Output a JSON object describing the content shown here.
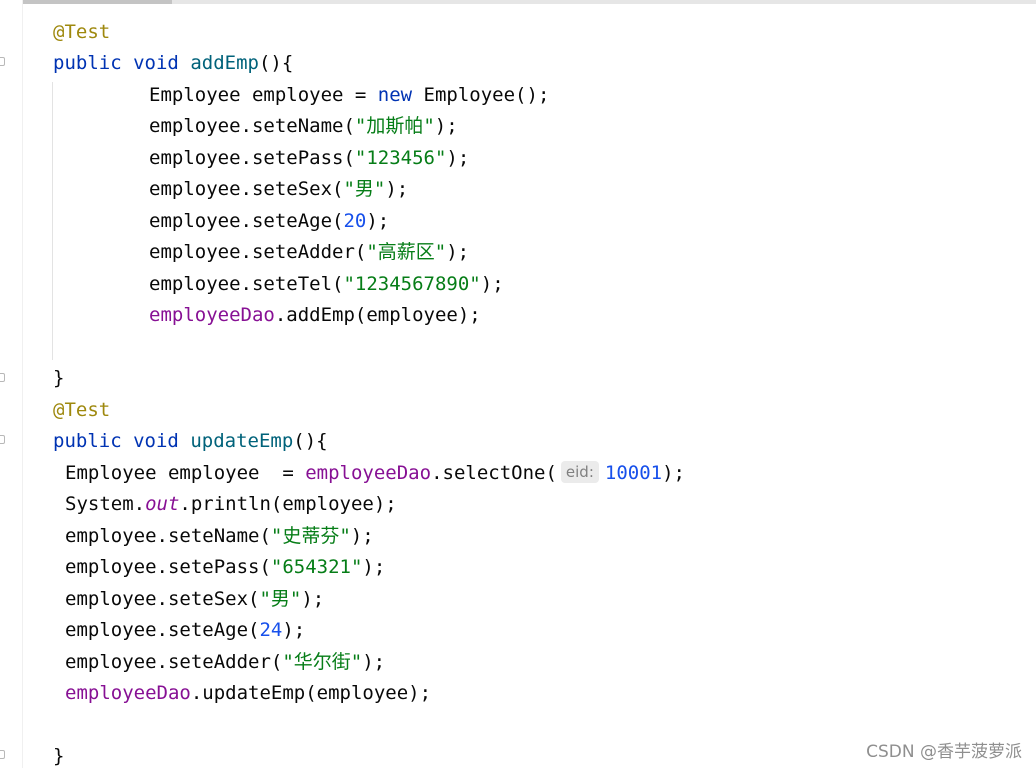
{
  "watermark": "CSDN @香芋菠萝派",
  "code": {
    "add_annotation": "@Test",
    "add_kw_public": "public",
    "add_kw_void": "void",
    "add_method_name": "addEmp",
    "add_method_open": "(){",
    "add_l1_type": "Employee employee = ",
    "add_l1_new": "new",
    "add_l1_ctor": " Employee();",
    "add_set_name_call": "employee.seteName(",
    "add_set_name_value": "\"加斯帕\"",
    "add_set_pass_call": "employee.setePass(",
    "add_set_pass_value": "\"123456\"",
    "add_set_sex_call": "employee.seteSex(",
    "add_set_sex_value": "\"男\"",
    "add_set_age_call": "employee.seteAge(",
    "add_set_age_value": "20",
    "add_set_adder_call": "employee.seteAdder(",
    "add_set_adder_value": "\"高薪区\"",
    "add_set_tel_call": "employee.seteTel(",
    "add_set_tel_value": "\"1234567890\"",
    "add_dao_field": "employeeDao",
    "add_dao_call": ".addEmp(employee);",
    "add_close": "}",
    "upd_annotation": "@Test",
    "upd_kw_public": "public",
    "upd_kw_void": "void",
    "upd_method_name": "updateEmp",
    "upd_method_open": "(){",
    "upd_l1_type": "Employee employee  = ",
    "upd_l1_dao_field": "employeeDao",
    "upd_l1_select": ".selectOne(",
    "upd_l1_hint": "eid:",
    "upd_l1_value": "10001",
    "upd_l1_end": ");",
    "upd_print_sys": "System.",
    "upd_print_out": "out",
    "upd_print_call": ".println(employee);",
    "upd_set_name_call": "employee.seteName(",
    "upd_set_name_value": "\"史蒂芬\"",
    "upd_set_pass_call": "employee.setePass(",
    "upd_set_pass_value": "\"654321\"",
    "upd_set_sex_call": "employee.seteSex(",
    "upd_set_sex_value": "\"男\"",
    "upd_set_age_call": "employee.seteAge(",
    "upd_set_age_value": "24",
    "upd_set_adder_call": "employee.seteAdder(",
    "upd_set_adder_value": "\"华尔街\"",
    "upd_dao_field": "employeeDao",
    "upd_dao_call": ".updateEmp(employee);",
    "upd_close": "}",
    "stmt_end": ");"
  },
  "colors": {
    "annotation": "#9e880d",
    "keyword": "#0033b3",
    "method": "#00627a",
    "field": "#871094",
    "string": "#067d17",
    "number": "#1750eb",
    "text": "#080808"
  }
}
